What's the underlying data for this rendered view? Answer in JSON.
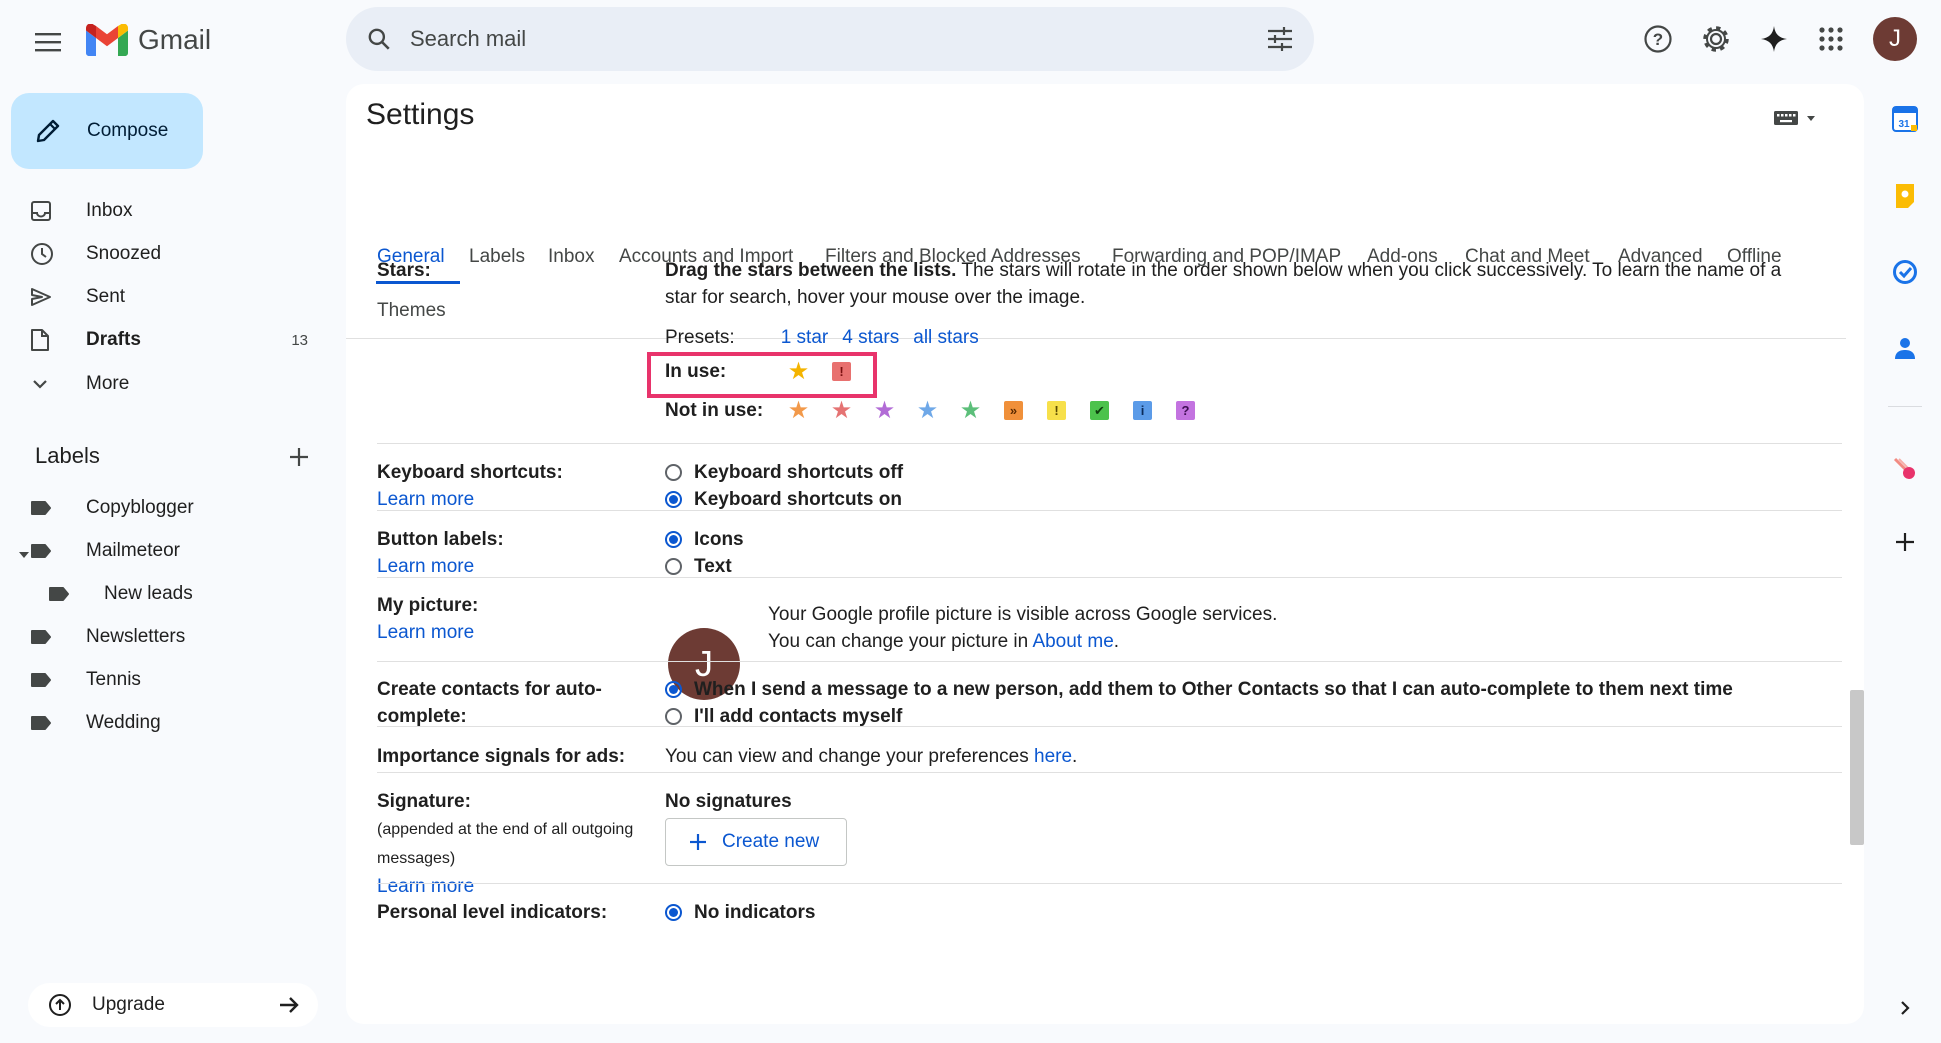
{
  "app": {
    "name": "Gmail"
  },
  "search": {
    "placeholder": "Search mail"
  },
  "header": {
    "avatar_letter": "J"
  },
  "compose": {
    "label": "Compose"
  },
  "nav": [
    {
      "label": "Inbox",
      "icon": "inbox-icon"
    },
    {
      "label": "Snoozed",
      "icon": "clock-icon"
    },
    {
      "label": "Sent",
      "icon": "send-icon"
    },
    {
      "label": "Drafts",
      "icon": "draft-icon",
      "count": "13"
    },
    {
      "label": "More",
      "icon": "chevron-down-icon"
    }
  ],
  "labels": {
    "heading": "Labels",
    "items": [
      {
        "label": "Copyblogger"
      },
      {
        "label": "Mailmeteor"
      },
      {
        "label": "New leads"
      },
      {
        "label": "Newsletters"
      },
      {
        "label": "Tennis"
      },
      {
        "label": "Wedding"
      }
    ]
  },
  "upgrade": {
    "label": "Upgrade"
  },
  "settings": {
    "title": "Settings",
    "tabs": [
      "General",
      "Labels",
      "Inbox",
      "Accounts and Import",
      "Filters and Blocked Addresses",
      "Forwarding and POP/IMAP",
      "Add-ons",
      "Chat and Meet",
      "Advanced",
      "Offline",
      "Themes"
    ],
    "active_tab": "General",
    "stars": {
      "label": "Stars:",
      "desc_bold": "Drag the stars between the lists.",
      "desc_line1": "The stars will rotate in the order shown below when you click successively. To learn the name of a",
      "desc_line2": "star for search, hover your mouse over the image.",
      "presets_label": "Presets:",
      "presets": [
        "1 star",
        "4 stars",
        "all stars"
      ],
      "in_use_label": "In use:",
      "not_in_use_label": "Not in use:"
    },
    "keyboard": {
      "label": "Keyboard shortcuts:",
      "learn": "Learn more",
      "off": "Keyboard shortcuts off",
      "on": "Keyboard shortcuts on",
      "selected": "on"
    },
    "button_labels": {
      "label": "Button labels:",
      "learn": "Learn more",
      "icons": "Icons",
      "text": "Text",
      "selected": "icons"
    },
    "picture": {
      "label": "My picture:",
      "learn": "Learn more",
      "letter": "J",
      "line1": "Your Google profile picture is visible across Google services.",
      "line2_pre": "You can change your picture in",
      "line2_link": "About me",
      "line2_post": "."
    },
    "contacts": {
      "label_line1": "Create contacts for auto-",
      "label_line2": "complete:",
      "opt1": "When I send a message to a new person, add them to Other Contacts so that I can auto-complete to them next time",
      "opt2": "I'll add contacts myself",
      "selected": "opt1"
    },
    "ads": {
      "label": "Importance signals for ads:",
      "text_pre": "You can view and change your preferences",
      "link": "here",
      "text_post": "."
    },
    "signature": {
      "label": "Signature:",
      "sub1": "(appended at the end of all outgoing",
      "sub2": "messages)",
      "learn": "Learn more",
      "none": "No signatures",
      "create": "Create new"
    },
    "personal": {
      "label": "Personal level indicators:",
      "opt1": "No indicators"
    }
  },
  "colors": {
    "accent": "#0b57d0",
    "compose_bg": "#c2e7ff",
    "highlight": "#e8336b",
    "avatar": "#6d3b34"
  }
}
